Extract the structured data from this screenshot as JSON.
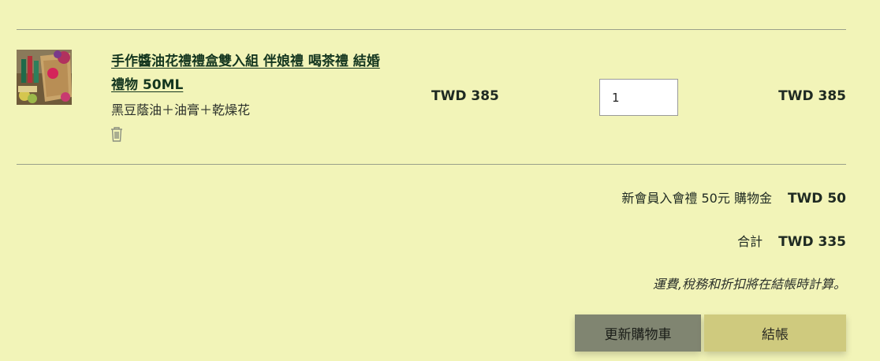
{
  "cart_item": {
    "title": "手作醬油花禮禮盒雙入組 伴娘禮 喝茶禮 結婚禮物 50ML",
    "variant": "黑豆蔭油＋油膏＋乾燥花",
    "price": "TWD 385",
    "quantity": "1",
    "line_total": "TWD 385",
    "image_icon": "product-thumbnail",
    "remove_icon": "trash-icon"
  },
  "summary": {
    "discount_label": "新會員入會禮 50元 購物金",
    "discount_amount": "TWD 50",
    "subtotal_label": "合計",
    "subtotal_amount": "TWD 335",
    "note": "運費,稅務和折扣將在結帳時計算。"
  },
  "buttons": {
    "update_label": "更新購物車",
    "checkout_label": "結帳"
  },
  "colors": {
    "background": "#f2f4b8",
    "update_button": "#808571",
    "checkout_button": "#cfca7e",
    "title_link": "#14361f"
  }
}
